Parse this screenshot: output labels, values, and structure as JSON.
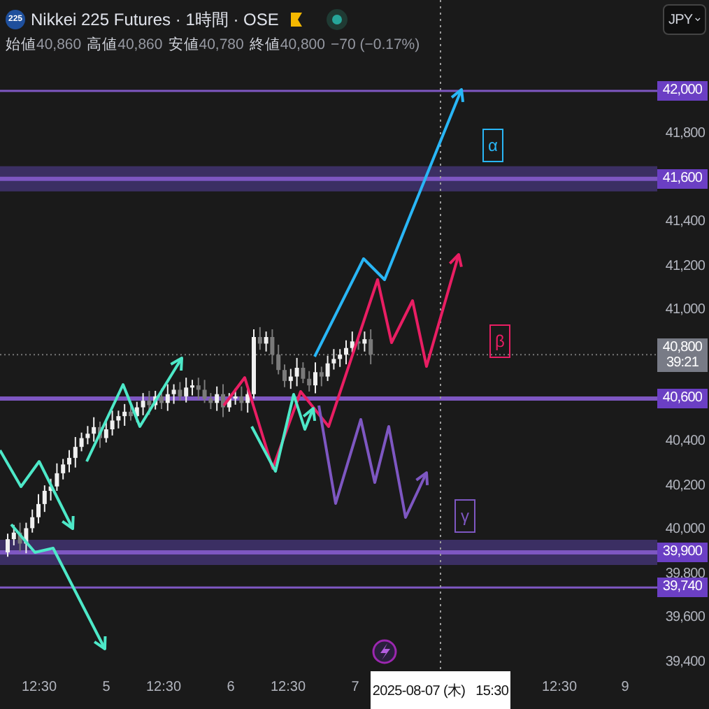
{
  "header": {
    "symbol_badge": "225",
    "title": "Nikkei 225 Futures · 1時間 · OSE",
    "ohlc": [
      {
        "label": "始値",
        "value": "40,860"
      },
      {
        "label": "高値",
        "value": "40,860"
      },
      {
        "label": "安値",
        "value": "40,780"
      },
      {
        "label": "終値",
        "value": "40,800"
      }
    ],
    "change": "−70 (−0.17%)"
  },
  "currency_button": "JPY",
  "price_axis": [
    {
      "kind": "level",
      "text": "42,000"
    },
    {
      "kind": "tick",
      "text": "41,800"
    },
    {
      "kind": "zone",
      "text": "41,600"
    },
    {
      "kind": "tick",
      "text": "41,400"
    },
    {
      "kind": "tick",
      "text": "41,200"
    },
    {
      "kind": "tick",
      "text": "41,000"
    },
    {
      "kind": "current",
      "text": "40,800",
      "countdown": "39:21"
    },
    {
      "kind": "level",
      "text": "40,600"
    },
    {
      "kind": "tick",
      "text": "40,400"
    },
    {
      "kind": "tick",
      "text": "40,200"
    },
    {
      "kind": "tick",
      "text": "40,000"
    },
    {
      "kind": "zone",
      "text": "39,900"
    },
    {
      "kind": "tick",
      "text": "39,800"
    },
    {
      "kind": "level",
      "text": "39,740"
    },
    {
      "kind": "tick",
      "text": "39,600"
    },
    {
      "kind": "tick",
      "text": "39,400"
    }
  ],
  "projections": [
    {
      "label": "α",
      "color": "#29b6f6"
    },
    {
      "label": "β",
      "color": "#e91e63"
    },
    {
      "label": "γ",
      "color": "#7e57c2"
    },
    {
      "color": "#4de8c8"
    }
  ],
  "time_axis": [
    "12:30",
    "5",
    "12:30",
    "6",
    "12:30",
    "7",
    "12:30",
    "9"
  ],
  "crosshair_label": "2025-08-07 (木)   15:30"
}
